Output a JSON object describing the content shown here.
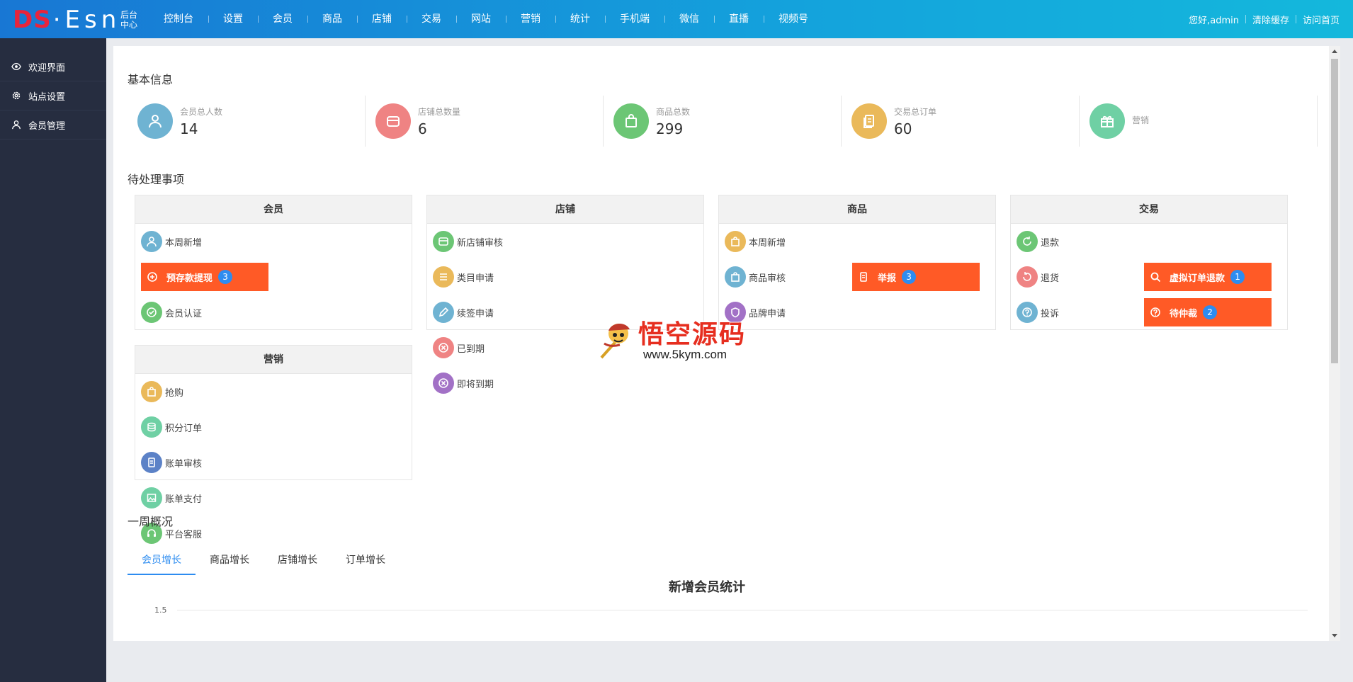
{
  "header": {
    "logo_ds": "DS",
    "logo_esn": "·Esn",
    "logo_sub": "后台中心",
    "nav": [
      "控制台",
      "设置",
      "会员",
      "商品",
      "店铺",
      "交易",
      "网站",
      "营销",
      "统计",
      "手机端",
      "微信",
      "直播",
      "视频号"
    ],
    "greeting": "您好,admin",
    "clear_cache": "清除缓存",
    "visit_home": "访问首页"
  },
  "sidebar": {
    "items": [
      {
        "label": "欢迎界面",
        "icon": "eye-icon"
      },
      {
        "label": "站点设置",
        "icon": "gear-icon"
      },
      {
        "label": "会员管理",
        "icon": "user-icon"
      }
    ]
  },
  "basic_info": {
    "title": "基本信息",
    "stats": [
      {
        "label": "会员总人数",
        "value": "14",
        "icon": "user-icon",
        "color": "#6fb3d2"
      },
      {
        "label": "店铺总数量",
        "value": "6",
        "icon": "store-icon",
        "color": "#ef8383"
      },
      {
        "label": "商品总数",
        "value": "299",
        "icon": "bag-icon",
        "color": "#6cc675"
      },
      {
        "label": "交易总订单",
        "value": "60",
        "icon": "order-icon",
        "color": "#eab95a"
      },
      {
        "label": "营销",
        "value": "",
        "icon": "gift-icon",
        "color": "#6fd0a4"
      }
    ]
  },
  "pending": {
    "title": "待处理事项",
    "boxes": [
      {
        "title": "会员",
        "items": [
          {
            "label": "本周新增",
            "icon": "user-icon",
            "color": "#6fb3d2"
          },
          {
            "label": "预存款提现",
            "badge": "3",
            "alert": true,
            "icon": "withdraw-icon"
          },
          {
            "label": "会员认证",
            "icon": "check-circle-icon",
            "color": "#6cc675"
          }
        ]
      },
      {
        "title": "店铺",
        "items": [
          {
            "label": "新店铺审核",
            "icon": "store-icon",
            "color": "#6cc675"
          },
          {
            "label": "类目申请",
            "icon": "list-icon",
            "color": "#eab95a"
          },
          {
            "label": "续签申请",
            "icon": "pencil-icon",
            "color": "#6fb3d2"
          },
          {
            "label": "已到期",
            "icon": "close-circle-icon",
            "color": "#ef8383"
          },
          {
            "label": "即将到期",
            "icon": "close-circle-icon",
            "color": "#a271c6"
          }
        ]
      },
      {
        "title": "商品",
        "items": [
          {
            "label": "本周新增",
            "icon": "bag-icon",
            "color": "#eab95a"
          },
          {
            "label": "商品审核",
            "icon": "bag-icon",
            "color": "#6fb3d2"
          },
          {
            "label": "举报",
            "badge": "3",
            "alert": true,
            "icon": "report-icon"
          },
          {
            "label": "品牌申请",
            "icon": "brand-icon",
            "color": "#a271c6"
          }
        ]
      },
      {
        "title": "交易",
        "items": [
          {
            "label": "退款",
            "icon": "refund-icon",
            "color": "#6cc675"
          },
          {
            "label": "退货",
            "icon": "return-icon",
            "color": "#ef8383"
          },
          {
            "label": "虚拟订单退款",
            "badge": "1",
            "alert": true,
            "icon": "search-icon"
          },
          {
            "label": "投诉",
            "icon": "question-icon",
            "color": "#6fb3d2"
          },
          {
            "label": "待仲裁",
            "badge": "2",
            "alert": true,
            "icon": "question-icon"
          }
        ]
      },
      {
        "title": "营销",
        "items": [
          {
            "label": "抢购",
            "icon": "bag-icon",
            "color": "#eab95a"
          },
          {
            "label": "积分订单",
            "icon": "coins-icon",
            "color": "#6fd0a4"
          },
          {
            "label": "账单审核",
            "icon": "doc-icon",
            "color": "#5c82c7"
          },
          {
            "label": "账单支付",
            "icon": "image-icon",
            "color": "#6fd0a4"
          },
          {
            "label": "平台客服",
            "icon": "headset-icon",
            "color": "#6cc675"
          }
        ]
      }
    ]
  },
  "weekly": {
    "title": "一周概况",
    "tabs": [
      "会员增长",
      "商品增长",
      "店铺增长",
      "订单增长"
    ],
    "active_tab": 0
  },
  "chart_data": {
    "type": "line",
    "title": "新增会员统计",
    "y_ticks": [
      "1.5"
    ]
  },
  "watermark": {
    "text": "悟空源码",
    "url": "www.5kym.com"
  }
}
